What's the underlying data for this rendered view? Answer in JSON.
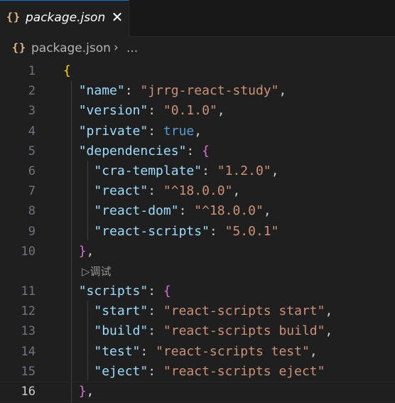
{
  "tab": {
    "icon": "{}",
    "icon_name": "json-braces-icon",
    "label": "package.json",
    "close": "✕"
  },
  "breadcrumb": {
    "icon": "{}",
    "file": "package.json",
    "separator": "›",
    "more": "..."
  },
  "codelens": {
    "label": "▷调试"
  },
  "lines": [
    {
      "n": "1",
      "tokens": [
        {
          "t": "{",
          "c": "br1"
        }
      ]
    },
    {
      "n": "2",
      "tokens": [
        {
          "t": "  "
        },
        {
          "t": "\"name\"",
          "c": "k"
        },
        {
          "t": ": ",
          "c": "p"
        },
        {
          "t": "\"jrrg-react-study\"",
          "c": "s"
        },
        {
          "t": ",",
          "c": "p"
        }
      ]
    },
    {
      "n": "3",
      "tokens": [
        {
          "t": "  "
        },
        {
          "t": "\"version\"",
          "c": "k"
        },
        {
          "t": ": ",
          "c": "p"
        },
        {
          "t": "\"0.1.0\"",
          "c": "s"
        },
        {
          "t": ",",
          "c": "p"
        }
      ]
    },
    {
      "n": "4",
      "tokens": [
        {
          "t": "  "
        },
        {
          "t": "\"private\"",
          "c": "k"
        },
        {
          "t": ": ",
          "c": "p"
        },
        {
          "t": "true",
          "c": "b"
        },
        {
          "t": ",",
          "c": "p"
        }
      ]
    },
    {
      "n": "5",
      "tokens": [
        {
          "t": "  "
        },
        {
          "t": "\"dependencies\"",
          "c": "k"
        },
        {
          "t": ": ",
          "c": "p"
        },
        {
          "t": "{",
          "c": "br2"
        }
      ]
    },
    {
      "n": "6",
      "tokens": [
        {
          "t": "    "
        },
        {
          "t": "\"cra-template\"",
          "c": "k"
        },
        {
          "t": ": ",
          "c": "p"
        },
        {
          "t": "\"1.2.0\"",
          "c": "s"
        },
        {
          "t": ",",
          "c": "p"
        }
      ]
    },
    {
      "n": "7",
      "tokens": [
        {
          "t": "    "
        },
        {
          "t": "\"react\"",
          "c": "k"
        },
        {
          "t": ": ",
          "c": "p"
        },
        {
          "t": "\"^18.0.0\"",
          "c": "s"
        },
        {
          "t": ",",
          "c": "p"
        }
      ]
    },
    {
      "n": "8",
      "tokens": [
        {
          "t": "    "
        },
        {
          "t": "\"react-dom\"",
          "c": "k"
        },
        {
          "t": ": ",
          "c": "p"
        },
        {
          "t": "\"^18.0.0\"",
          "c": "s"
        },
        {
          "t": ",",
          "c": "p"
        }
      ]
    },
    {
      "n": "9",
      "tokens": [
        {
          "t": "    "
        },
        {
          "t": "\"react-scripts\"",
          "c": "k"
        },
        {
          "t": ": ",
          "c": "p"
        },
        {
          "t": "\"5.0.1\"",
          "c": "s"
        }
      ]
    },
    {
      "n": "10",
      "tokens": [
        {
          "t": "  "
        },
        {
          "t": "}",
          "c": "br2"
        },
        {
          "t": ",",
          "c": "p"
        }
      ]
    },
    {
      "n": "11",
      "tokens": [
        {
          "t": "  "
        },
        {
          "t": "\"scripts\"",
          "c": "k"
        },
        {
          "t": ": ",
          "c": "p"
        },
        {
          "t": "{",
          "c": "br2"
        }
      ]
    },
    {
      "n": "12",
      "tokens": [
        {
          "t": "    "
        },
        {
          "t": "\"start\"",
          "c": "k"
        },
        {
          "t": ": ",
          "c": "p"
        },
        {
          "t": "\"react-scripts start\"",
          "c": "s"
        },
        {
          "t": ",",
          "c": "p"
        }
      ]
    },
    {
      "n": "13",
      "tokens": [
        {
          "t": "    "
        },
        {
          "t": "\"build\"",
          "c": "k"
        },
        {
          "t": ": ",
          "c": "p"
        },
        {
          "t": "\"react-scripts build\"",
          "c": "s"
        },
        {
          "t": ",",
          "c": "p"
        }
      ]
    },
    {
      "n": "14",
      "tokens": [
        {
          "t": "    "
        },
        {
          "t": "\"test\"",
          "c": "k"
        },
        {
          "t": ": ",
          "c": "p"
        },
        {
          "t": "\"react-scripts test\"",
          "c": "s"
        },
        {
          "t": ",",
          "c": "p"
        }
      ]
    },
    {
      "n": "15",
      "tokens": [
        {
          "t": "    "
        },
        {
          "t": "\"eject\"",
          "c": "k"
        },
        {
          "t": ": ",
          "c": "p"
        },
        {
          "t": "\"react-scripts eject\"",
          "c": "s"
        }
      ]
    },
    {
      "n": "16",
      "tokens": [
        {
          "t": "  "
        },
        {
          "t": "}",
          "c": "br2"
        },
        {
          "t": ",",
          "c": "p"
        }
      ],
      "current": true
    }
  ],
  "colors": {
    "editor_bg": "#1f1f1f",
    "json_key": "#9cdcfe",
    "json_string": "#ce9178",
    "json_boolean": "#569cd6",
    "bracket_level1": "#ffd700",
    "bracket_level2": "#da70d6",
    "icon_json": "#e2c08d",
    "tab_active_border": "#0078d4"
  }
}
